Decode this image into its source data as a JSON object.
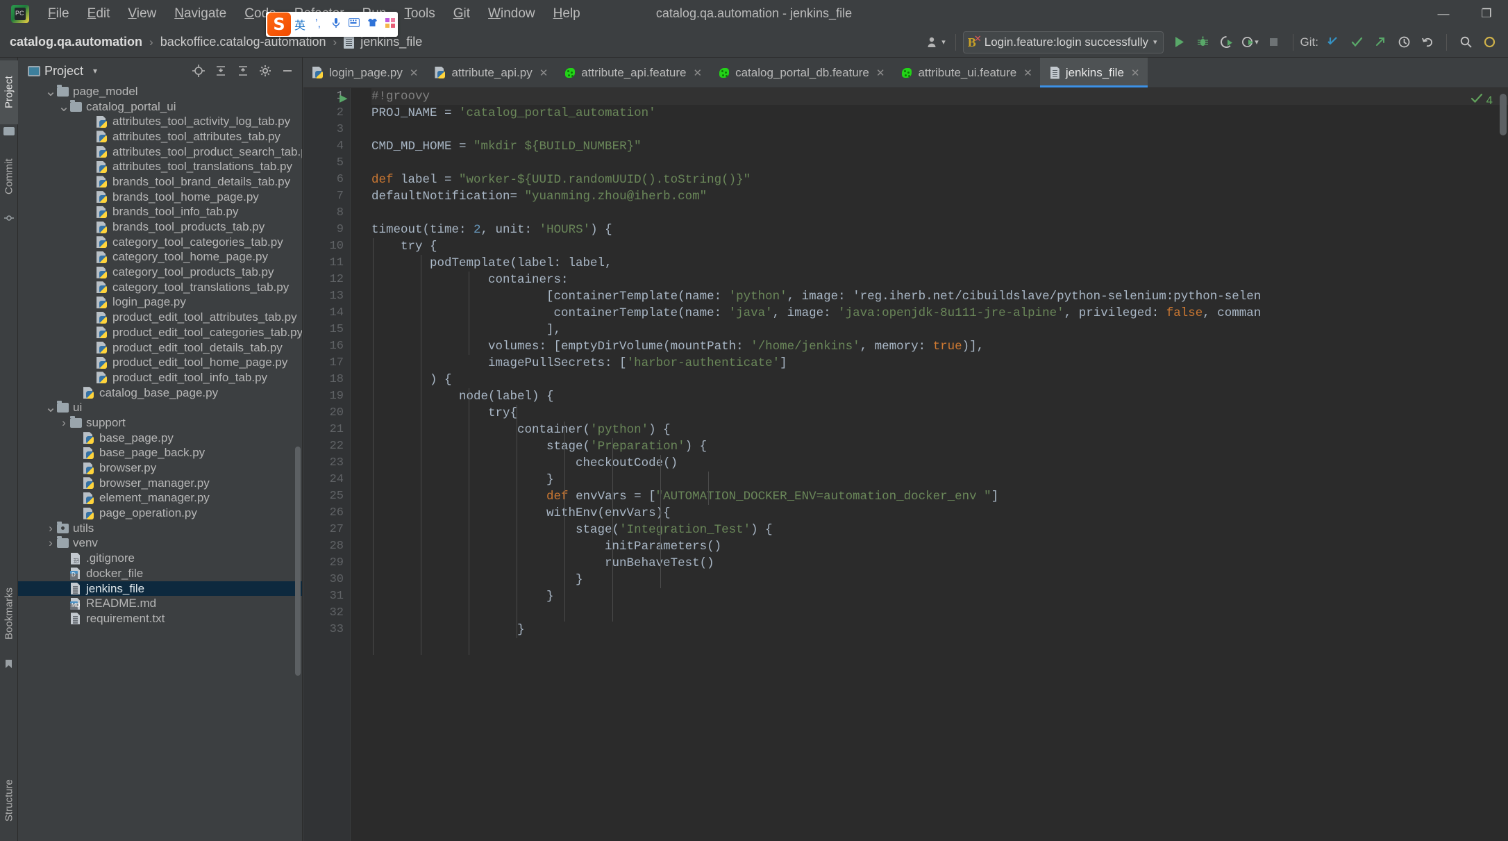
{
  "window": {
    "title": "catalog.qa.automation - jenkins_file",
    "app_icon": "pycharm-logo-icon",
    "controls": {
      "minimize": "—",
      "restore": "❐",
      "close": "✕"
    }
  },
  "menubar": [
    {
      "label": "File",
      "mnemonic": "F"
    },
    {
      "label": "Edit",
      "mnemonic": "E"
    },
    {
      "label": "View",
      "mnemonic": "V"
    },
    {
      "label": "Navigate",
      "mnemonic": "N"
    },
    {
      "label": "Code",
      "mnemonic": "C"
    },
    {
      "label": "Refactor",
      "mnemonic": "R"
    },
    {
      "label": "Run",
      "mnemonic": "n"
    },
    {
      "label": "Tools",
      "mnemonic": "T"
    },
    {
      "label": "Git",
      "mnemonic": "G"
    },
    {
      "label": "Window",
      "mnemonic": "W"
    },
    {
      "label": "Help",
      "mnemonic": "H"
    }
  ],
  "ime_bar": {
    "logo": "sogou-ime-logo",
    "items": [
      "英",
      "’,",
      "🎙",
      "⌨",
      "👕",
      "▣"
    ]
  },
  "breadcrumb": {
    "items": [
      "catalog.qa.automation",
      "backoffice.catalog-automation",
      "jenkins_file"
    ],
    "separator": "›",
    "file_icon": "jenkins-file-icon"
  },
  "toolbar": {
    "account_icon": "account-icon",
    "run_config": {
      "icon": "behave-config-icon",
      "label": "Login.feature:login successfully",
      "caret": "▾"
    },
    "run_button": "run-icon",
    "debug_button": "debug-icon",
    "run_coverage_button": "run-with-coverage-icon",
    "profile_button": "profile-icon",
    "stop_button": "stop-icon",
    "git_label": "Git:",
    "git_update_icon": "update-project-icon",
    "git_commit_icon": "commit-icon",
    "git_push_icon": "push-icon",
    "history_icon": "history-icon",
    "undo_icon": "undo-icon",
    "search_icon": "search-everywhere-icon",
    "accent": "#3c91e6"
  },
  "left_strip": [
    {
      "label": "Project",
      "active": true,
      "icon": "project-icon"
    },
    {
      "label": "Commit",
      "active": false,
      "icon": "commit-icon"
    },
    {
      "label": "Bookmarks",
      "active": false,
      "icon": "bookmark-icon"
    },
    {
      "label": "Structure",
      "active": false,
      "icon": "structure-icon"
    }
  ],
  "sidebar": {
    "title": "Project",
    "title_caret": "▾",
    "actions": [
      "locate-icon",
      "expand-all-icon",
      "collapse-all-icon",
      "settings-icon",
      "hide-icon"
    ],
    "tree": [
      {
        "label": "page_model",
        "indent": 2,
        "type": "folder",
        "arrow": "∨"
      },
      {
        "label": "catalog_portal_ui",
        "indent": 3,
        "type": "folder",
        "arrow": "∨"
      },
      {
        "label": "attributes_tool_activity_log_tab.py",
        "indent": 5,
        "type": "py",
        "arrow": ""
      },
      {
        "label": "attributes_tool_attributes_tab.py",
        "indent": 5,
        "type": "py",
        "arrow": ""
      },
      {
        "label": "attributes_tool_product_search_tab.py",
        "indent": 5,
        "type": "py",
        "arrow": ""
      },
      {
        "label": "attributes_tool_translations_tab.py",
        "indent": 5,
        "type": "py",
        "arrow": ""
      },
      {
        "label": "brands_tool_brand_details_tab.py",
        "indent": 5,
        "type": "py",
        "arrow": ""
      },
      {
        "label": "brands_tool_home_page.py",
        "indent": 5,
        "type": "py",
        "arrow": ""
      },
      {
        "label": "brands_tool_info_tab.py",
        "indent": 5,
        "type": "py",
        "arrow": ""
      },
      {
        "label": "brands_tool_products_tab.py",
        "indent": 5,
        "type": "py",
        "arrow": ""
      },
      {
        "label": "category_tool_categories_tab.py",
        "indent": 5,
        "type": "py",
        "arrow": ""
      },
      {
        "label": "category_tool_home_page.py",
        "indent": 5,
        "type": "py",
        "arrow": ""
      },
      {
        "label": "category_tool_products_tab.py",
        "indent": 5,
        "type": "py",
        "arrow": ""
      },
      {
        "label": "category_tool_translations_tab.py",
        "indent": 5,
        "type": "py",
        "arrow": ""
      },
      {
        "label": "login_page.py",
        "indent": 5,
        "type": "py",
        "arrow": ""
      },
      {
        "label": "product_edit_tool_attributes_tab.py",
        "indent": 5,
        "type": "py",
        "arrow": ""
      },
      {
        "label": "product_edit_tool_categories_tab.py",
        "indent": 5,
        "type": "py",
        "arrow": ""
      },
      {
        "label": "product_edit_tool_details_tab.py",
        "indent": 5,
        "type": "py",
        "arrow": ""
      },
      {
        "label": "product_edit_tool_home_page.py",
        "indent": 5,
        "type": "py",
        "arrow": ""
      },
      {
        "label": "product_edit_tool_info_tab.py",
        "indent": 5,
        "type": "py",
        "arrow": ""
      },
      {
        "label": "catalog_base_page.py",
        "indent": 4,
        "type": "py",
        "arrow": ""
      },
      {
        "label": "ui",
        "indent": 2,
        "type": "folder",
        "arrow": "∨"
      },
      {
        "label": "support",
        "indent": 3,
        "type": "folder",
        "arrow": "›"
      },
      {
        "label": "base_page.py",
        "indent": 4,
        "type": "py",
        "arrow": ""
      },
      {
        "label": "base_page_back.py",
        "indent": 4,
        "type": "py",
        "arrow": ""
      },
      {
        "label": "browser.py",
        "indent": 4,
        "type": "py",
        "arrow": ""
      },
      {
        "label": "browser_manager.py",
        "indent": 4,
        "type": "py",
        "arrow": ""
      },
      {
        "label": "element_manager.py",
        "indent": 4,
        "type": "py",
        "arrow": ""
      },
      {
        "label": "page_operation.py",
        "indent": 4,
        "type": "py",
        "arrow": ""
      },
      {
        "label": "utils",
        "indent": 2,
        "type": "folder-src",
        "arrow": "›"
      },
      {
        "label": "venv",
        "indent": 2,
        "type": "folder",
        "arrow": "›"
      },
      {
        "label": ".gitignore",
        "indent": 3,
        "type": "gitignore",
        "arrow": ""
      },
      {
        "label": "docker_file",
        "indent": 3,
        "type": "file-badge",
        "badge": "D",
        "arrow": ""
      },
      {
        "label": "jenkins_file",
        "indent": 3,
        "type": "file",
        "arrow": "",
        "selected": true
      },
      {
        "label": "README.md",
        "indent": 3,
        "type": "file-badge",
        "badge": "MD",
        "arrow": ""
      },
      {
        "label": "requirement.txt",
        "indent": 3,
        "type": "file",
        "arrow": ""
      }
    ]
  },
  "editor": {
    "tabs": [
      {
        "label": "login_page.py",
        "icon": "python-file-icon",
        "active": false,
        "close": "✕"
      },
      {
        "label": "attribute_api.py",
        "icon": "python-file-icon",
        "active": false,
        "close": "✕"
      },
      {
        "label": "attribute_api.feature",
        "icon": "cucumber-file-icon",
        "active": false,
        "close": "✕"
      },
      {
        "label": "catalog_portal_db.feature",
        "icon": "cucumber-file-icon",
        "active": false,
        "close": "✕"
      },
      {
        "label": "attribute_ui.feature",
        "icon": "cucumber-file-icon",
        "active": false,
        "close": "✕"
      },
      {
        "label": "jenkins_file",
        "icon": "jenkins-file-icon",
        "active": true,
        "close": "✕"
      }
    ],
    "inspection": {
      "icon": "inspection-check-icon",
      "count": "4",
      "caret": "▴"
    },
    "language": "groovy",
    "lines": [
      {
        "n": 1,
        "text": "#!groovy",
        "runnable": true
      },
      {
        "n": 2,
        "text": "PROJ_NAME = 'catalog_portal_automation'"
      },
      {
        "n": 3,
        "text": ""
      },
      {
        "n": 4,
        "text": "CMD_MD_HOME = \"mkdir ${BUILD_NUMBER}\""
      },
      {
        "n": 5,
        "text": ""
      },
      {
        "n": 6,
        "text": "def label = \"worker-${UUID.randomUUID().toString()}\""
      },
      {
        "n": 7,
        "text": "defaultNotification= \"yuanming.zhou@iherb.com\""
      },
      {
        "n": 8,
        "text": ""
      },
      {
        "n": 9,
        "text": "timeout(time: 2, unit: 'HOURS') {"
      },
      {
        "n": 10,
        "text": "    try {"
      },
      {
        "n": 11,
        "text": "        podTemplate(label: label,"
      },
      {
        "n": 12,
        "text": "                containers:"
      },
      {
        "n": 13,
        "text": "                        [containerTemplate(name: 'python', image: 'reg.iherb.net/cibuildslave/python-selenium:python-selen"
      },
      {
        "n": 14,
        "text": "                         containerTemplate(name: 'java', image: 'java:openjdk-8u111-jre-alpine', privileged: false, comman"
      },
      {
        "n": 15,
        "text": "                        ],"
      },
      {
        "n": 16,
        "text": "                volumes: [emptyDirVolume(mountPath: '/home/jenkins', memory: true)],"
      },
      {
        "n": 17,
        "text": "                imagePullSecrets: ['harbor-authenticate']"
      },
      {
        "n": 18,
        "text": "        ) {"
      },
      {
        "n": 19,
        "text": "            node(label) {"
      },
      {
        "n": 20,
        "text": "                try{"
      },
      {
        "n": 21,
        "text": "                    container('python') {"
      },
      {
        "n": 22,
        "text": "                        stage('Preparation') {"
      },
      {
        "n": 23,
        "text": "                            checkoutCode()"
      },
      {
        "n": 24,
        "text": "                        }"
      },
      {
        "n": 25,
        "text": "                        def envVars = [\"AUTOMATION_DOCKER_ENV=automation_docker_env \"]"
      },
      {
        "n": 26,
        "text": "                        withEnv(envVars){"
      },
      {
        "n": 27,
        "text": "                            stage('Integration_Test') {"
      },
      {
        "n": 28,
        "text": "                                initParameters()"
      },
      {
        "n": 29,
        "text": "                                runBehaveTest()"
      },
      {
        "n": 30,
        "text": "                            }"
      },
      {
        "n": 31,
        "text": "                        }"
      },
      {
        "n": 32,
        "text": ""
      },
      {
        "n": 33,
        "text": "                    }"
      }
    ]
  }
}
